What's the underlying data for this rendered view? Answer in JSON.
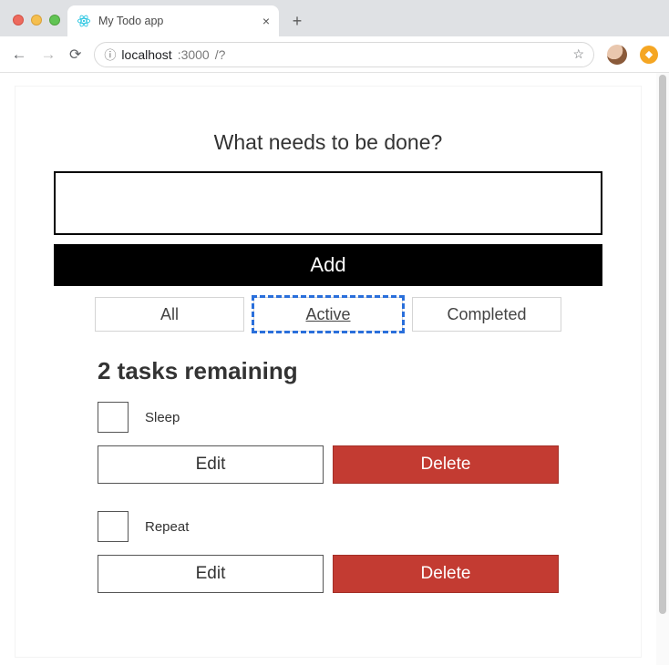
{
  "browser": {
    "tab_title": "My Todo app",
    "url_host": "localhost",
    "url_port": ":3000",
    "url_rest": "/?",
    "new_tab_glyph": "+",
    "close_glyph": "×",
    "star_glyph": "☆",
    "back_glyph": "←",
    "forward_glyph": "→",
    "reload_glyph": "⟳",
    "info_glyph": "ⓘ",
    "ext_glyph": "◆"
  },
  "app": {
    "prompt": "What needs to be done?",
    "input_value": "",
    "add_label": "Add",
    "filters": {
      "all": "All",
      "active": "Active",
      "completed": "Completed",
      "selected": "active"
    },
    "remaining_text": "2 tasks remaining",
    "edit_label": "Edit",
    "delete_label": "Delete",
    "tasks": [
      {
        "label": "Sleep",
        "checked": false
      },
      {
        "label": "Repeat",
        "checked": false
      }
    ]
  }
}
